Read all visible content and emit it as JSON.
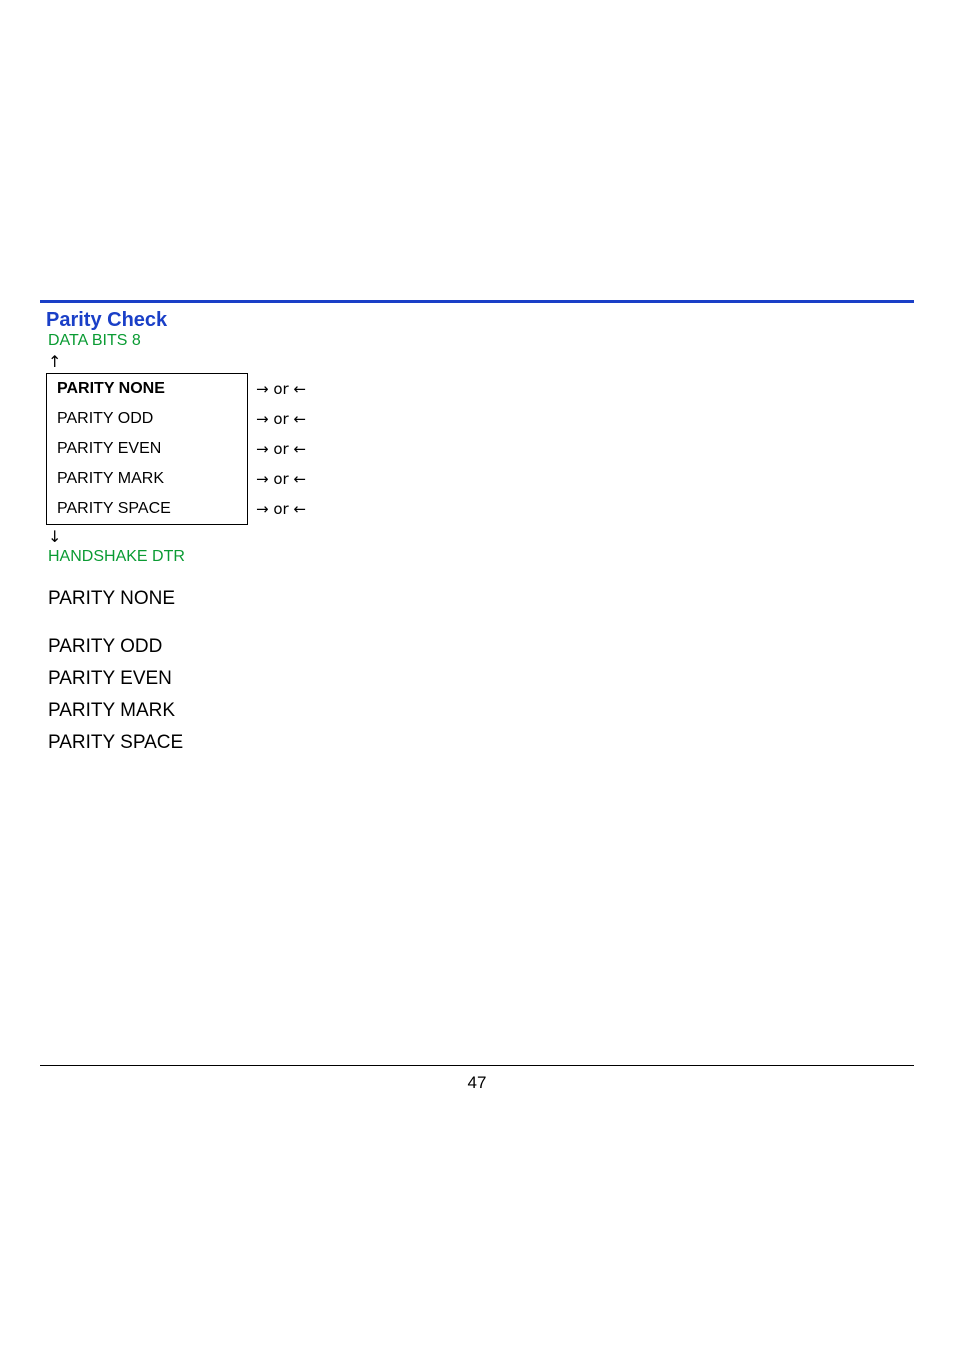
{
  "section": {
    "title": "Parity Check",
    "prev_label": "DATA BITS 8",
    "up_arrow": "↑",
    "down_arrow": "↓",
    "next_label": "HANDSHAKE DTR"
  },
  "menu": {
    "action_label": "→ or ←",
    "items": [
      {
        "label": "PARITY NONE",
        "selected": true
      },
      {
        "label": "PARITY ODD",
        "selected": false
      },
      {
        "label": "PARITY EVEN",
        "selected": false
      },
      {
        "label": "PARITY MARK",
        "selected": false
      },
      {
        "label": "PARITY SPACE",
        "selected": false
      }
    ]
  },
  "descriptions": [
    "PARITY NONE",
    "PARITY ODD",
    "PARITY EVEN",
    "PARITY MARK",
    "PARITY SPACE"
  ],
  "page_number": "47"
}
